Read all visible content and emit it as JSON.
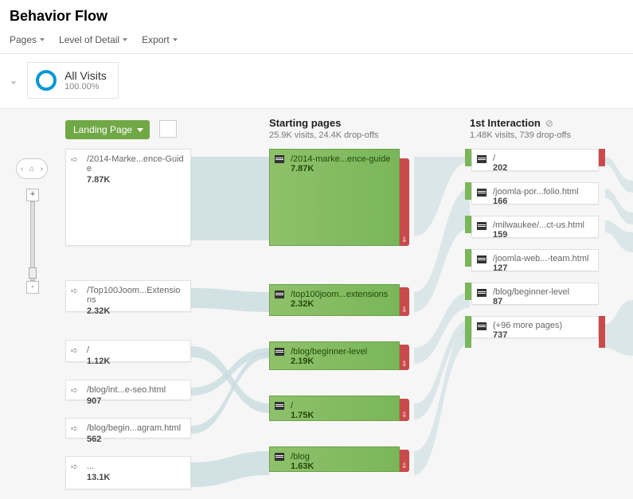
{
  "header": {
    "title": "Behavior Flow"
  },
  "toolbar": {
    "pages": "Pages",
    "detail": "Level of Detail",
    "export": "Export"
  },
  "segment": {
    "name": "All Visits",
    "pct": "100.00%"
  },
  "dimension": {
    "label": "Landing Page"
  },
  "columns": {
    "starting": {
      "title": "Starting pages",
      "sub": "25.9K visits, 24.4K drop-offs"
    },
    "first": {
      "title": "1st Interaction",
      "sub": "1.48K visits, 739 drop-offs"
    }
  },
  "landing": [
    {
      "label": "/2014-Marke...ence-Guide",
      "val": "7.87K"
    },
    {
      "label": "/Top100Joom...Extensions",
      "val": "2.32K"
    },
    {
      "label": "/",
      "val": "1.12K"
    },
    {
      "label": "/blog/int...e-seo.html",
      "val": "907"
    },
    {
      "label": "/blog/begin...agram.html",
      "val": "562"
    },
    {
      "label": "...",
      "val": "13.1K"
    }
  ],
  "starting": [
    {
      "label": "/2014-marke...ence-guide",
      "val": "7.87K"
    },
    {
      "label": "/top100joom...extensions",
      "val": "2.32K"
    },
    {
      "label": "/blog/beginner-level",
      "val": "2.19K"
    },
    {
      "label": "/",
      "val": "1.75K"
    },
    {
      "label": "/blog",
      "val": "1.63K"
    }
  ],
  "first": [
    {
      "label": "/",
      "val": "202"
    },
    {
      "label": "/joomla-por...folio.html",
      "val": "166"
    },
    {
      "label": "/milwaukee/...ct-us.html",
      "val": "159"
    },
    {
      "label": "/joomla-web...-team.html",
      "val": "127"
    },
    {
      "label": "/blog/beginner-level",
      "val": "87"
    },
    {
      "label": "(+96 more pages)",
      "val": "737"
    }
  ]
}
